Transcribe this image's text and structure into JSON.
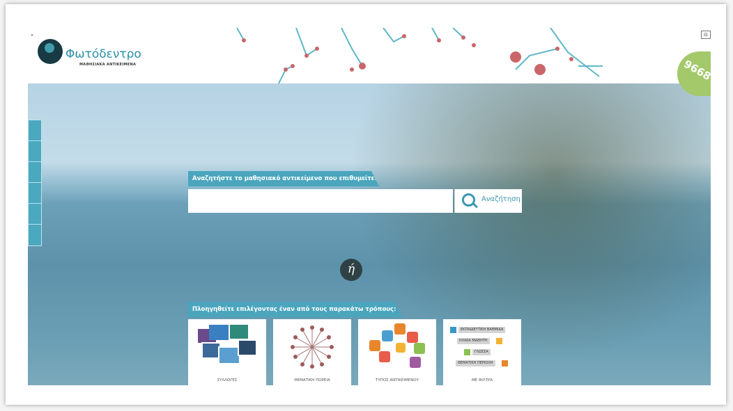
{
  "header": {
    "site_title": "Φωτόδεντρο",
    "site_subtitle": "ΜΑΘΗΣΙΑΚΑ ΑΝΤΙΚΕΙΜΕΝΑ",
    "counter": "9668"
  },
  "search": {
    "prompt": "Αναζητήστε το μαθησιακό αντικείμενο που επιθυμείτε:",
    "placeholder": "",
    "button_label": "Αναζήτηση"
  },
  "or_label": "ή",
  "browse": {
    "prompt": "Πλοηγηθείτε επιλέγοντας έναν από τους παρακάτω τρόπους:",
    "cards": [
      {
        "label": "ΣΥΛΛΟΓΕΣ"
      },
      {
        "label": "ΘΕΜΑΤΙΚΗ ΠΟΡΕΙΑ"
      },
      {
        "label": "ΤΥΠΟΣ ΑΝΤΙΚΕΙΜΕΝΟΥ"
      },
      {
        "label": "ΜΕ ΦΙΛΤΡΑ"
      }
    ],
    "filters": [
      {
        "label": "ΕΚΠΑΙΔΕΥΤΙΚΗ ΒΑΘΜΙΔΑ",
        "color": "#3a97c8"
      },
      {
        "label": "ΗΛΙΚΙΑ ΜΑΘΗΤΗ",
        "color": "#f2b233"
      },
      {
        "label": "ΓΛΩΣΣΑ",
        "color": "#8cc152"
      },
      {
        "label": "ΘΕΜΑΤΙΚΗ ΠΕΡΙΟΧΗ",
        "color": "#e8862c"
      }
    ]
  },
  "colors": {
    "accent": "#4aa5bd",
    "counter_green": "#a3c96a",
    "logo_dark": "#173a45"
  }
}
